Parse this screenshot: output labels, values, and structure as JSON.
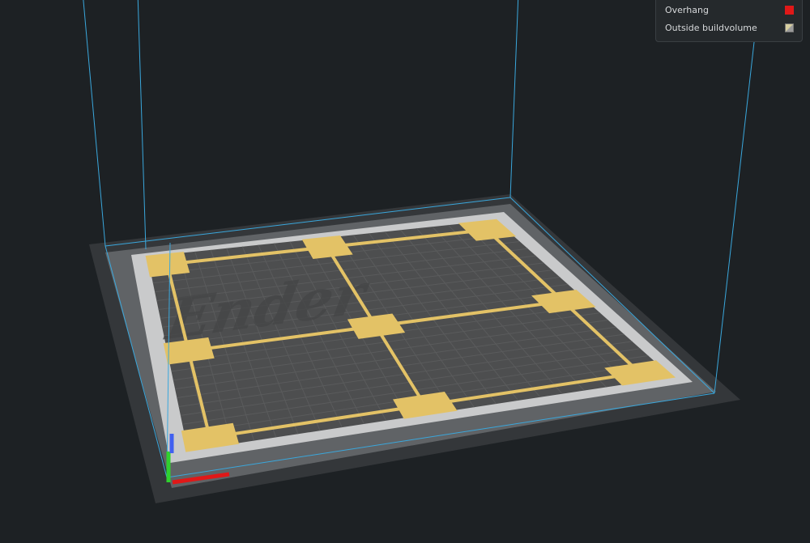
{
  "legend": {
    "items": [
      {
        "label": "Overhang",
        "color": "#e01818",
        "icon": "overhang-swatch-icon"
      },
      {
        "label": "Outside buildvolume",
        "color": "#c8c0a0",
        "icon": "outside-buildvolume-swatch-icon"
      }
    ]
  },
  "bed": {
    "logo_text": "Ender",
    "colors": {
      "background": "#1d2124",
      "plate_outer": "#34373a",
      "plate_border": "#606366",
      "disallowed_zone": "#c9cacb",
      "print_area": "#4d4e4f",
      "grid_line": "#5a5b5c",
      "support_model": "#e3c266",
      "build_volume_lines": "#3aa7dc"
    }
  },
  "axes": {
    "x_color": "#e01818",
    "y_color": "#2fd12f",
    "z_color": "#4060f0"
  }
}
